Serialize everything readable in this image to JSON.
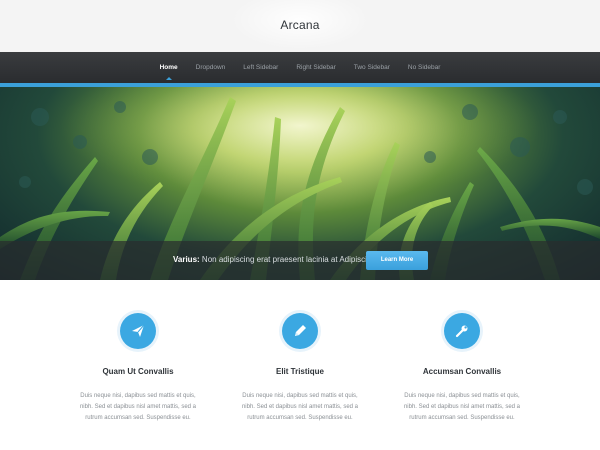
{
  "site": {
    "title": "Arcana"
  },
  "nav": {
    "items": [
      {
        "label": "Home",
        "active": true
      },
      {
        "label": "Dropdown",
        "active": false
      },
      {
        "label": "Left Sidebar",
        "active": false
      },
      {
        "label": "Right Sidebar",
        "active": false
      },
      {
        "label": "Two Sidebar",
        "active": false
      },
      {
        "label": "No Sidebar",
        "active": false
      }
    ]
  },
  "banner": {
    "caption_strong": "Varius:",
    "caption_text": "Non adipiscing erat praesent lacinia at Adipiscing",
    "button_label": "Learn More"
  },
  "features": [
    {
      "icon": "paper-plane-icon",
      "title": "Quam Ut Convallis",
      "text": "Duis neque nisi, dapibus sed mattis et quis, nibh. Sed et dapibus nisl amet mattis, sed a rutrum accumsan sed. Suspendisse eu."
    },
    {
      "icon": "pencil-icon",
      "title": "Elit Tristique",
      "text": "Duis neque nisi, dapibus sed mattis et quis, nibh. Sed et dapibus nisl amet mattis, sed a rutrum accumsan sed. Suspendisse eu."
    },
    {
      "icon": "wrench-icon",
      "title": "Accumsan Convallis",
      "text": "Duis neque nisi, dapibus sed mattis et quis, nibh. Sed et dapibus nisl amet mattis, sed a rutrum accumsan sed. Suspendisse eu."
    }
  ],
  "colors": {
    "accent": "#3ba0d9",
    "nav_bg": "#2f3134",
    "banner_green": "#5d8a3a"
  }
}
